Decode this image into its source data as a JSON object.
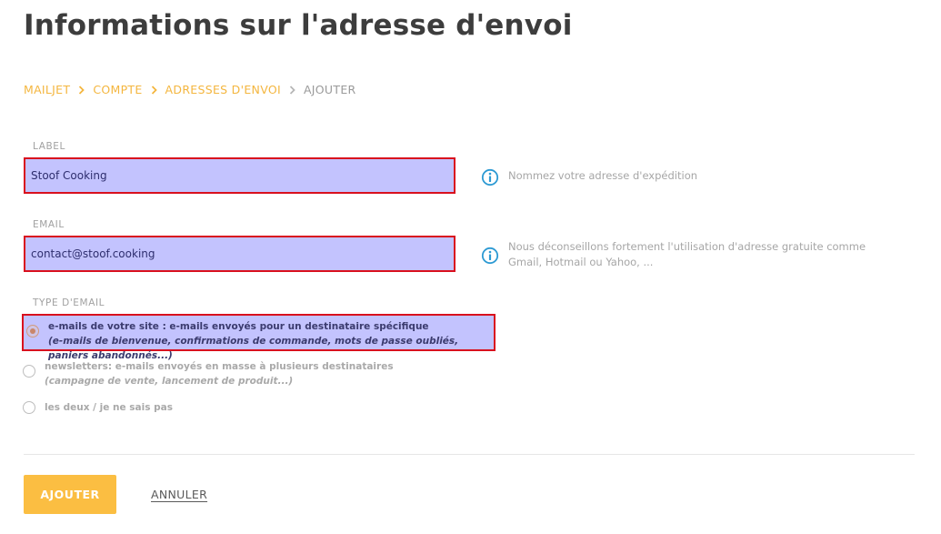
{
  "page": {
    "title": "Informations sur l'adresse d'envoi"
  },
  "breadcrumb": {
    "items": [
      "MAILJET",
      "COMPTE",
      "ADRESSES D'ENVOI"
    ],
    "current": "AJOUTER"
  },
  "form": {
    "label_field": {
      "label": "LABEL",
      "value": "Stoof Cooking",
      "hint": "Nommez votre adresse d'expédition"
    },
    "email_field": {
      "label": "EMAIL",
      "value": "contact@stoof.cooking",
      "hint": "Nous déconseillons fortement l'utilisation d'adresse gratuite comme Gmail, Hotmail ou Yahoo, ..."
    },
    "email_type": {
      "label": "TYPE D'EMAIL",
      "selected_index": 0,
      "options": [
        {
          "main": "e-mails de votre site : e-mails envoyés pour un destinataire spécifique",
          "sub": "(e-mails de bienvenue, confirmations de commande, mots de passe oubliés, paniers abandonnés...)"
        },
        {
          "main": "newsletters: e-mails envoyés en masse à plusieurs destinataires",
          "sub": "(campagne de vente, lancement de produit...)"
        },
        {
          "main": "les deux / je ne sais pas",
          "sub": ""
        }
      ]
    }
  },
  "actions": {
    "submit_label": "AJOUTER",
    "cancel_label": "ANNULER"
  },
  "colors": {
    "accent": "#fbbe42",
    "link": "#f4b63f",
    "info_icon": "#2d9ad3",
    "highlight": "#c3c3fe",
    "highlight_border": "#d9101e"
  },
  "icons": {
    "breadcrumb_separator": "chevron-right-icon",
    "hint": "info-icon"
  }
}
